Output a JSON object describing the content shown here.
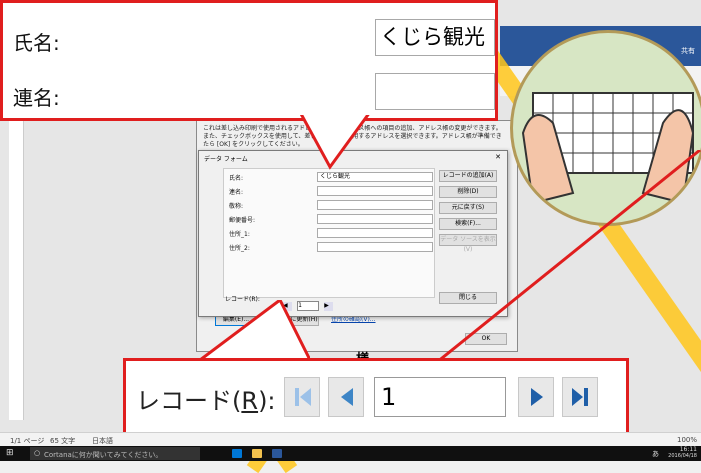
{
  "top_callout": {
    "name_label": "氏名:",
    "name_value": "くじら観光",
    "renmei_label": "連名:",
    "renmei_value": ""
  },
  "data_form": {
    "title": "データ フォーム",
    "fields": [
      {
        "label": "氏名:",
        "value": "くじら観光"
      },
      {
        "label": "連名:",
        "value": ""
      },
      {
        "label": "敬称:",
        "value": ""
      },
      {
        "label": "郵便番号:",
        "value": ""
      },
      {
        "label": "住所_1:",
        "value": ""
      },
      {
        "label": "住所_2:",
        "value": ""
      }
    ],
    "buttons": [
      "レコードの追加(A)",
      "削除(D)",
      "元に戻す(S)",
      "検索(F)...",
      "データ ソースを表示(V)"
    ],
    "record_label": "レコード(R):",
    "record_value": "1",
    "close_label": "閉じる"
  },
  "mail_merge": {
    "info_text": "これは差し込み印刷で使用されるアドレス帳です。アドレス帳への項目の追加、アドレス帳の変更ができます。また、チェックボックスを使用して、差し込み印刷で使用するアドレスを選択できます。アドレス帳が準備できたら [OK] をクリックしてください。",
    "edit_button": "編集(E)...",
    "refresh_button": "最新の情報に更新(H)",
    "validate_link": "住所の確認(V)...",
    "ok_button": "OK",
    "doc_text": "様"
  },
  "bottom_callout": {
    "record_label": "レコード(",
    "record_underlined": "R",
    "record_suffix": "):",
    "record_value": "1"
  },
  "status_bar": {
    "page": "1/1 ページ",
    "chars": "65 文字",
    "lang": "日本語",
    "zoom": "100%"
  },
  "taskbar": {
    "cortana": "Cortanaに何か聞いてみてください。",
    "time": "16:11",
    "date": "2016/04/18",
    "ime": "あ"
  },
  "ribbon": {
    "share": "共有"
  }
}
